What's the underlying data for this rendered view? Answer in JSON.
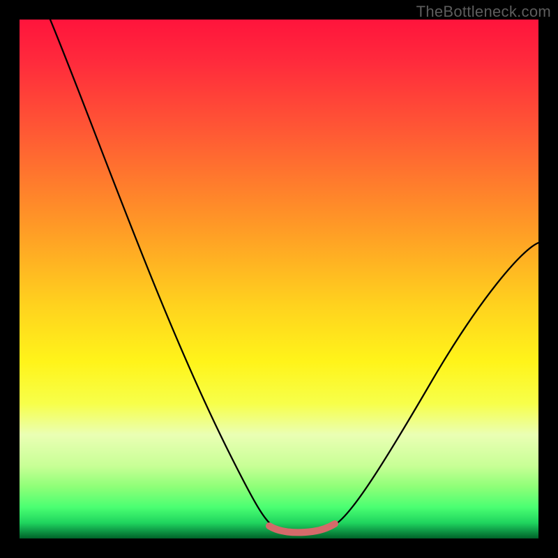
{
  "watermark": "TheBottleneck.com",
  "colors": {
    "frame": "#000000",
    "watermark": "#5d5d5d",
    "curve_black": "#000000",
    "curve_red_bottom": "#d46a6a"
  },
  "chart_data": {
    "type": "line",
    "title": "",
    "xlabel": "",
    "ylabel": "",
    "xlim": [
      0,
      100
    ],
    "ylim": [
      0,
      100
    ],
    "grid": false,
    "legend": false,
    "description": "V-shaped bottleneck curve over a red-to-green vertical gradient. Only the narrow flat segment near the bottom is highlighted in red, indicating the region of minimal bottleneck.",
    "series": [
      {
        "name": "bottleneck-curve",
        "x": [
          6,
          10,
          14,
          18,
          22,
          26,
          30,
          34,
          38,
          42,
          45,
          48,
          50,
          52,
          55,
          58,
          60,
          62,
          66,
          72,
          80,
          88,
          96,
          100
        ],
        "values": [
          100,
          91,
          82,
          73,
          64,
          55,
          46,
          37,
          28,
          19,
          12,
          6,
          3,
          1.5,
          1.2,
          1.5,
          2.2,
          3.5,
          7,
          14,
          25,
          37,
          47,
          53
        ]
      },
      {
        "name": "optimal-band",
        "x": [
          49,
          51,
          53,
          55,
          57,
          59,
          61
        ],
        "values": [
          2.2,
          1.6,
          1.3,
          1.2,
          1.4,
          1.9,
          2.8
        ]
      }
    ]
  }
}
